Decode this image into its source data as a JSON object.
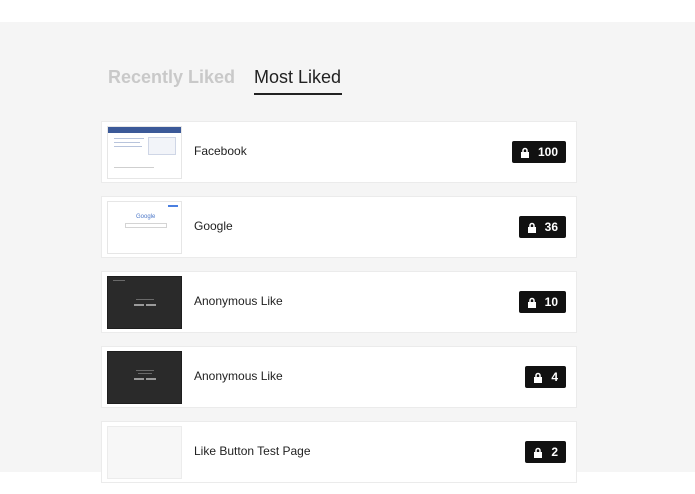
{
  "tabs": {
    "recently_liked": "Recently Liked",
    "most_liked": "Most Liked"
  },
  "items": [
    {
      "name": "Facebook",
      "count": "100",
      "thumbnail": "facebook-screenshot"
    },
    {
      "name": "Google",
      "count": "36",
      "thumbnail": "google-screenshot"
    },
    {
      "name": "Anonymous Like",
      "count": "10",
      "thumbnail": "dark-page-screenshot"
    },
    {
      "name": "Anonymous Like",
      "count": "4",
      "thumbnail": "dark-page-screenshot"
    },
    {
      "name": "Like Button Test Page",
      "count": "2",
      "thumbnail": "blank-page"
    }
  ],
  "colors": {
    "badge_background": "#111111",
    "background": "#f5f5f5",
    "active_tab_text": "#222222",
    "inactive_tab_text": "#c9c9c9"
  }
}
